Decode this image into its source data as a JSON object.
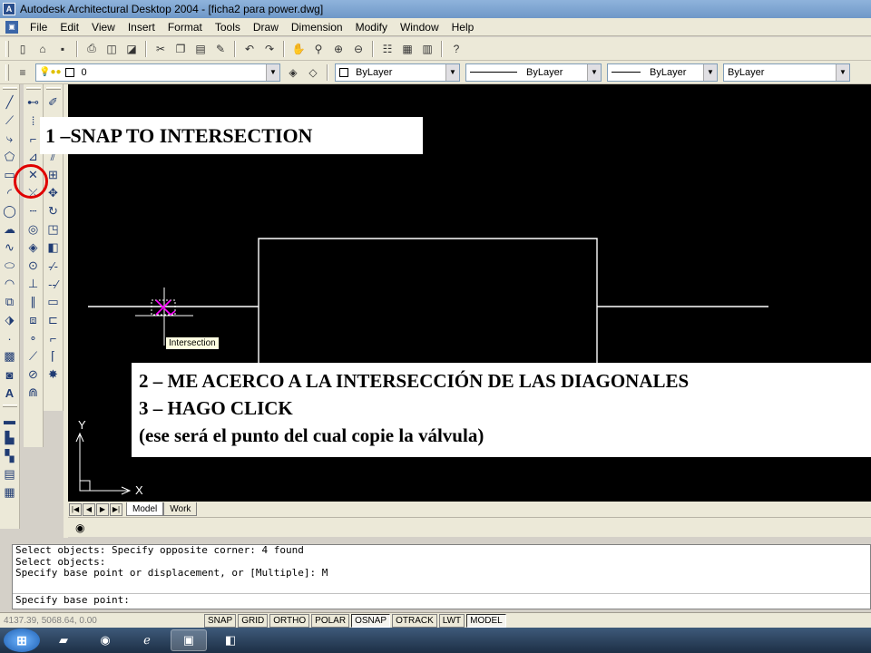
{
  "window": {
    "title": "Autodesk Architectural Desktop 2004 - [ficha2 para power.dwg]"
  },
  "menu": [
    "File",
    "Edit",
    "View",
    "Insert",
    "Format",
    "Tools",
    "Draw",
    "Dimension",
    "Modify",
    "Window",
    "Help"
  ],
  "layers": {
    "current_layer": "0",
    "color": "ByLayer",
    "linetype": "ByLayer",
    "lineweight": "ByLayer",
    "plotstyle": "ByLayer"
  },
  "drawing": {
    "background_color": "#000000",
    "line_color": "#ffffff",
    "snap_marker_color": "#ff00ff",
    "ucs_axis_y": "Y",
    "ucs_axis_x": "X"
  },
  "tooltip": {
    "text": "Intersection"
  },
  "callouts": {
    "step1": "1 –SNAP  TO INTERSECTION",
    "step2": "2 – ME ACERCO A LA INTERSECCIÓN DE LAS DIAGONALES",
    "step3": "3 – HAGO CLICK",
    "step3_note": "(ese será el punto del cual copie la válvula)"
  },
  "highlight": {
    "color": "#e00000"
  },
  "layout_tabs": [
    {
      "label": "Model",
      "active": true
    },
    {
      "label": "Work",
      "active": false
    }
  ],
  "command_window": {
    "history": [
      "Select objects: Specify opposite corner: 4 found",
      "Select objects:",
      "Specify base point or displacement, or [Multiple]: M"
    ],
    "prompt": "Specify base point:"
  },
  "status": {
    "coordinates": "4137.39, 5068.64, 0.00",
    "buttons": [
      {
        "label": "SNAP",
        "on": false
      },
      {
        "label": "GRID",
        "on": false
      },
      {
        "label": "ORTHO",
        "on": false
      },
      {
        "label": "POLAR",
        "on": false
      },
      {
        "label": "OSNAP",
        "on": true
      },
      {
        "label": "OTRACK",
        "on": false
      },
      {
        "label": "LWT",
        "on": false
      },
      {
        "label": "MODEL",
        "on": true
      }
    ]
  }
}
